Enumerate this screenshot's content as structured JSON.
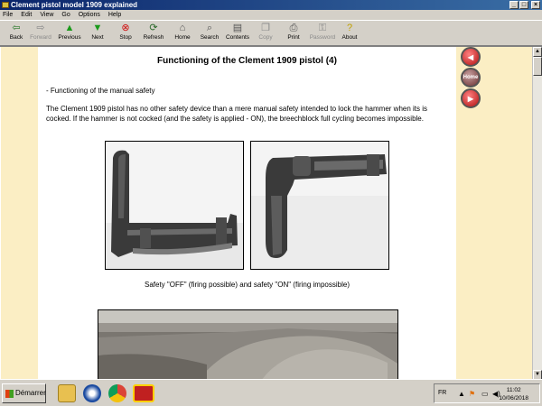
{
  "window": {
    "title": "Clement pistol model 1909 explained"
  },
  "menu": [
    "File",
    "Edit",
    "View",
    "Go",
    "Options",
    "Help"
  ],
  "toolbar": {
    "buttons": [
      {
        "label": "Back",
        "icon": "back-arrow-icon",
        "enabled": true
      },
      {
        "label": "Forward",
        "icon": "forward-arrow-icon",
        "enabled": false
      },
      {
        "label": "Previous",
        "icon": "up-arrow-icon",
        "enabled": true
      },
      {
        "label": "Next",
        "icon": "down-arrow-icon",
        "enabled": true
      },
      {
        "label": "Stop",
        "icon": "stop-icon",
        "enabled": true
      },
      {
        "label": "Refresh",
        "icon": "refresh-icon",
        "enabled": true
      },
      {
        "label": "Home",
        "icon": "home-icon",
        "enabled": true
      },
      {
        "label": "Search",
        "icon": "search-icon",
        "enabled": true
      },
      {
        "label": "Contents",
        "icon": "contents-icon",
        "enabled": true
      },
      {
        "label": "Copy",
        "icon": "copy-icon",
        "enabled": false
      },
      {
        "label": "Print",
        "icon": "print-icon",
        "enabled": true
      },
      {
        "label": "Password",
        "icon": "key-icon",
        "enabled": false
      },
      {
        "label": "About",
        "icon": "about-icon",
        "enabled": true
      }
    ]
  },
  "page": {
    "title": "Functioning of the Clement 1909 pistol (4)",
    "section_heading": "- Functioning of the manual safety",
    "paragraph": "The Clement 1909 pistol has no other safety device than a mere manual safety intended to lock the hammer when its is cocked. If the hammer is not cocked (and the safety is applied - ON), the breechblock full cycling becomes impossible.",
    "caption": "Safety \"OFF\" (firing possible) and safety \"ON\" (firing impossible)"
  },
  "side_nav": {
    "home_label": "Home"
  },
  "taskbar": {
    "start_label": "Démarrer",
    "language": "FR",
    "time": "11:02",
    "date": "10/06/2018"
  },
  "colors": {
    "sidebar": "#fbeec4",
    "titlebar": "#0a246a",
    "nav_button": "#c01818"
  }
}
